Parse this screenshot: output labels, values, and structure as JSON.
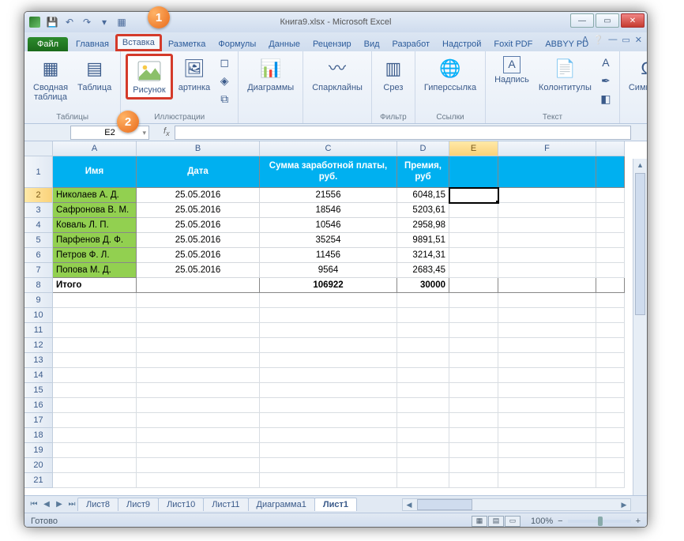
{
  "title": "Книга9.xlsx - Microsoft Excel",
  "tabs": {
    "file": "Файл",
    "home": "Главная",
    "insert": "Вставка",
    "layout": "Разметка",
    "formulas": "Формулы",
    "data": "Данные",
    "review": "Рецензир",
    "view": "Вид",
    "dev": "Разработ",
    "addins": "Надстрой",
    "foxit": "Foxit PDF",
    "abbyy": "ABBYY PD"
  },
  "ribbon": {
    "pivot": "Сводная\nтаблица",
    "table": "Таблица",
    "picture": "Рисунок",
    "clipart": "артинка",
    "charts": "Диаграммы",
    "sparklines": "Спарклайны",
    "slicer": "Срез",
    "link": "Гиперссылка",
    "textbox": "Надпись",
    "headerfooter": "Колонтитулы",
    "symbols": "Символы",
    "grp_tables": "Таблицы",
    "grp_illus": "Иллюстрации",
    "grp_filter": "Фильтр",
    "grp_links": "Ссылки",
    "grp_text": "Текст"
  },
  "namebox": "E2",
  "columns": [
    "A",
    "B",
    "C",
    "D",
    "E",
    "F"
  ],
  "headers": {
    "name": "Имя",
    "date": "Дата",
    "sum": "Сумма заработной платы, руб.",
    "bonus": "Премия, руб"
  },
  "rows": [
    {
      "n": "2",
      "name": "Николаев А. Д.",
      "date": "25.05.2016",
      "sum": "21556",
      "bonus": "6048,15"
    },
    {
      "n": "3",
      "name": "Сафронова В. М.",
      "date": "25.05.2016",
      "sum": "18546",
      "bonus": "5203,61"
    },
    {
      "n": "4",
      "name": "Коваль Л. П.",
      "date": "25.05.2016",
      "sum": "10546",
      "bonus": "2958,98"
    },
    {
      "n": "5",
      "name": "Парфенов Д. Ф.",
      "date": "25.05.2016",
      "sum": "35254",
      "bonus": "9891,51"
    },
    {
      "n": "6",
      "name": "Петров Ф. Л.",
      "date": "25.05.2016",
      "sum": "11456",
      "bonus": "3214,31"
    },
    {
      "n": "7",
      "name": "Попова М. Д.",
      "date": "25.05.2016",
      "sum": "9564",
      "bonus": "2683,45"
    }
  ],
  "total": {
    "n": "8",
    "label": "Итого",
    "sum": "106922",
    "bonus": "30000"
  },
  "empty_rows": [
    "9",
    "10",
    "11",
    "12",
    "13",
    "14",
    "15",
    "16",
    "17",
    "18",
    "19",
    "20",
    "21"
  ],
  "sheets": [
    "Лист8",
    "Лист9",
    "Лист10",
    "Лист11",
    "Диаграмма1",
    "Лист1"
  ],
  "status": "Готово",
  "zoom": "100%",
  "callouts": {
    "c1": "1",
    "c2": "2"
  }
}
